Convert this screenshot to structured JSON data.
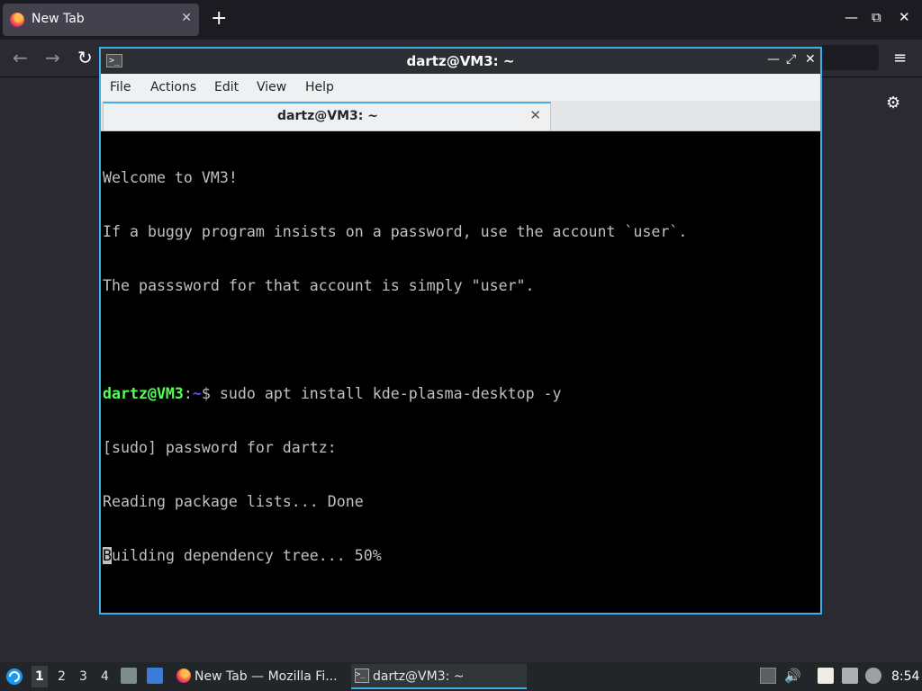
{
  "browser": {
    "tab_title": "New Tab",
    "tab_close": "✕",
    "new_tab": "+",
    "window_controls": {
      "minimize": "—",
      "maximize": "⧉",
      "close": "✕"
    },
    "nav": {
      "back": "←",
      "forward": "→",
      "reload": "↻",
      "menu": "≡",
      "settings": "⚙"
    }
  },
  "terminal": {
    "window_title": "dartz@VM3: ~",
    "icon_glyph": ">_",
    "title_buttons": {
      "minimize": "—",
      "restore": "⤢",
      "close": "✕"
    },
    "menu": [
      "File",
      "Actions",
      "Edit",
      "View",
      "Help"
    ],
    "tab_label": "dartz@VM3: ~",
    "tab_close": "✕",
    "lines": [
      "Welcome to VM3!",
      "If a buggy program insists on a password, use the account `user`.",
      "The passsword for that account is simply \"user\".",
      ""
    ],
    "prompt": {
      "user_host": "dartz@VM3",
      "sep": ":",
      "path": "~",
      "symbol": "$ ",
      "command": "sudo apt install kde-plasma-desktop -y"
    },
    "output": [
      "[sudo] password for dartz:",
      "Reading package lists... Done"
    ],
    "last_line_cursor_char": "B",
    "last_line_rest": "uilding dependency tree... 50%"
  },
  "taskbar": {
    "workspaces": [
      "1",
      "2",
      "3",
      "4"
    ],
    "active_workspace": "1",
    "tasks": [
      {
        "label": "New Tab — Mozilla Fi...",
        "icon": "firefox-icon"
      },
      {
        "label": "dartz@VM3: ~",
        "icon": "terminal-icon"
      }
    ],
    "clock": "8:54"
  }
}
